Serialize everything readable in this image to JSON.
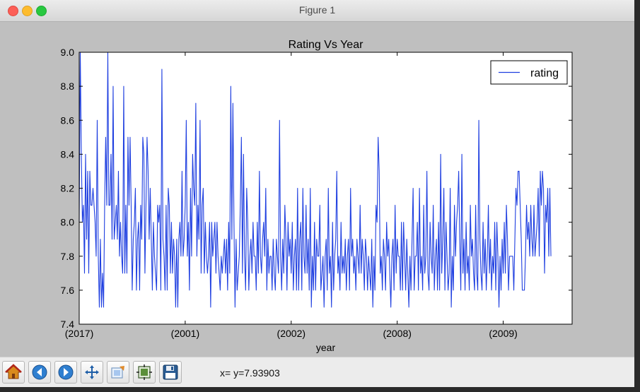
{
  "window": {
    "title": "Figure 1"
  },
  "toolbar": {
    "buttons": [
      {
        "name": "home-button",
        "icon": "home-icon"
      },
      {
        "name": "back-button",
        "icon": "arrow-left-icon"
      },
      {
        "name": "forward-button",
        "icon": "arrow-right-icon"
      },
      {
        "name": "pan-button",
        "icon": "move-icon"
      },
      {
        "name": "zoom-button",
        "icon": "zoom-rect-icon"
      },
      {
        "name": "subplots-button",
        "icon": "subplots-icon"
      },
      {
        "name": "save-button",
        "icon": "floppy-disk-icon"
      }
    ],
    "coords": "x= y=7.93903"
  },
  "chart_data": {
    "type": "line",
    "title": "Rating Vs Year",
    "xlabel": "year",
    "ylabel": "",
    "ylim": [
      7.4,
      9.0
    ],
    "yticks": [
      7.4,
      7.6,
      7.8,
      8.0,
      8.2,
      8.4,
      8.6,
      8.8,
      9.0
    ],
    "xticks": [
      0,
      100,
      200,
      300,
      400
    ],
    "xtick_labels": [
      "(2017)",
      "(2001)",
      "(2002)",
      "(2008)",
      "(2009)"
    ],
    "xlim": [
      0,
      465
    ],
    "grid": false,
    "legend": "top-right",
    "color": "#1f3fe0",
    "series": [
      {
        "name": "rating",
        "values": [
          8.0,
          9.0,
          8.4,
          8.0,
          8.1,
          7.7,
          8.4,
          7.9,
          8.3,
          7.7,
          8.3,
          8.1,
          8.1,
          8.2,
          8.1,
          8.0,
          7.8,
          8.6,
          7.8,
          7.5,
          7.9,
          7.5,
          7.7,
          7.5,
          8.1,
          8.5,
          8.1,
          9.0,
          8.1,
          8.1,
          8.4,
          7.9,
          8.8,
          7.9,
          8.0,
          8.1,
          7.9,
          8.3,
          7.8,
          8.0,
          7.8,
          7.7,
          8.8,
          7.7,
          8.1,
          7.7,
          8.5,
          8.1,
          8.5,
          8.1,
          7.6,
          7.9,
          8.0,
          8.2,
          7.6,
          7.9,
          8.0,
          7.6,
          8.1,
          7.9,
          8.5,
          8.4,
          7.7,
          8.1,
          8.5,
          8.3,
          7.9,
          8.2,
          7.9,
          7.6,
          8.0,
          7.8,
          7.7,
          7.6,
          8.1,
          8.0,
          8.1,
          7.6,
          8.9,
          7.9,
          7.8,
          7.6,
          8.1,
          7.6,
          8.2,
          8.1,
          7.7,
          8.0,
          7.7,
          7.9,
          7.8,
          7.5,
          7.9,
          7.5,
          7.9,
          8.0,
          7.8,
          8.3,
          7.8,
          7.9,
          8.1,
          8.6,
          7.8,
          8.0,
          7.6,
          8.2,
          7.8,
          8.4,
          8.2,
          8.1,
          8.7,
          7.8,
          8.1,
          7.9,
          8.6,
          7.7,
          8.1,
          8.2,
          7.7,
          8.0,
          7.8,
          7.7,
          7.8,
          8.0,
          7.5,
          8.0,
          7.8,
          7.9,
          8.0,
          7.7,
          8.0,
          7.8,
          7.7,
          7.6,
          7.8,
          7.7,
          7.8,
          7.9,
          7.7,
          7.9,
          7.6,
          8.0,
          7.7,
          8.8,
          7.9,
          8.7,
          8.0,
          7.5,
          7.9,
          7.6,
          7.7,
          7.8,
          8.1,
          8.5,
          7.7,
          8.4,
          7.8,
          7.6,
          8.2,
          8.0,
          7.6,
          7.8,
          7.9,
          7.7,
          8.0,
          7.8,
          7.8,
          7.6,
          8.0,
          7.7,
          8.3,
          7.8,
          7.7,
          7.9,
          8.0,
          7.8,
          8.2,
          7.6,
          7.9,
          7.7,
          7.8,
          7.8,
          7.6,
          7.9,
          7.7,
          7.6,
          7.9,
          7.8,
          7.7,
          8.6,
          7.8,
          7.6,
          7.9,
          7.7,
          8.1,
          7.9,
          7.6,
          8.0,
          7.8,
          7.9,
          7.7,
          8.0,
          7.6,
          7.8,
          7.9,
          7.6,
          8.2,
          7.6,
          7.9,
          8.0,
          7.6,
          8.2,
          7.8,
          7.7,
          8.1,
          7.7,
          7.9,
          7.6,
          8.2,
          7.5,
          7.8,
          7.6,
          8.0,
          7.6,
          7.9,
          7.8,
          7.8,
          8.1,
          7.6,
          7.7,
          7.8,
          7.5,
          7.8,
          7.9,
          7.6,
          8.2,
          7.7,
          7.8,
          7.5,
          8.0,
          7.6,
          7.8,
          7.9,
          8.3,
          7.7,
          7.8,
          7.6,
          8.0,
          7.7,
          7.8,
          7.7,
          7.9,
          7.6,
          7.8,
          7.9,
          7.6,
          8.2,
          7.8,
          7.9,
          7.7,
          7.8,
          7.6,
          7.9,
          7.8,
          7.7,
          8.1,
          7.7,
          7.9,
          7.8,
          7.6,
          7.9,
          7.8,
          7.6,
          7.8,
          7.7,
          7.6,
          7.9,
          7.5,
          7.8,
          7.6,
          8.1,
          8.0,
          8.5,
          8.3,
          7.7,
          7.8,
          7.6,
          7.9,
          7.8,
          7.6,
          8.0,
          7.8,
          7.9,
          7.7,
          7.5,
          7.8,
          7.9,
          7.6,
          8.1,
          7.7,
          7.9,
          7.8,
          7.8,
          7.6,
          8.0,
          7.6,
          8.0,
          7.8,
          7.6,
          7.9,
          7.7,
          7.5,
          7.8,
          7.6,
          7.9,
          8.2,
          7.6,
          7.8,
          7.8,
          8.0,
          7.6,
          8.2,
          7.7,
          7.8,
          7.6,
          8.1,
          7.7,
          7.8,
          8.3,
          7.7,
          7.6,
          8.0,
          7.8,
          7.7,
          8.1,
          7.6,
          7.8,
          7.9,
          7.6,
          8.0,
          7.6,
          8.4,
          7.7,
          7.9,
          8.2,
          7.6,
          8.0,
          7.8,
          7.6,
          7.7,
          8.2,
          7.5,
          7.8,
          7.6,
          8.1,
          7.8,
          8.0,
          8.1,
          8.3,
          7.9,
          7.6,
          8.4,
          7.7,
          7.9,
          7.6,
          8.0,
          7.7,
          7.8,
          7.6,
          8.1,
          7.8,
          7.9,
          7.7,
          7.6,
          8.1,
          7.7,
          7.6,
          8.6,
          7.9,
          7.7,
          7.6,
          8.0,
          7.7,
          7.9,
          7.6,
          7.8,
          8.1,
          7.7,
          7.9,
          7.6,
          7.8,
          7.7,
          8.0,
          7.6,
          8.0,
          7.8,
          7.5,
          7.8,
          7.6,
          7.9,
          7.7,
          8.0,
          7.7,
          8.1,
          7.9,
          7.6,
          7.8,
          7.8,
          7.8,
          7.8,
          7.6,
          7.9,
          8.2,
          8.1,
          8.3,
          8.3,
          8.1,
          7.9,
          7.6,
          7.6,
          7.6,
          7.8,
          8.1,
          7.9,
          8.0,
          7.8,
          8.1,
          7.9,
          7.8,
          8.1,
          7.8,
          7.9,
          8.0,
          8.2,
          7.8,
          8.3,
          8.1,
          8.3,
          8.2,
          7.7,
          8.1,
          8.0,
          8.2,
          7.8,
          8.2,
          7.8
        ]
      }
    ]
  }
}
